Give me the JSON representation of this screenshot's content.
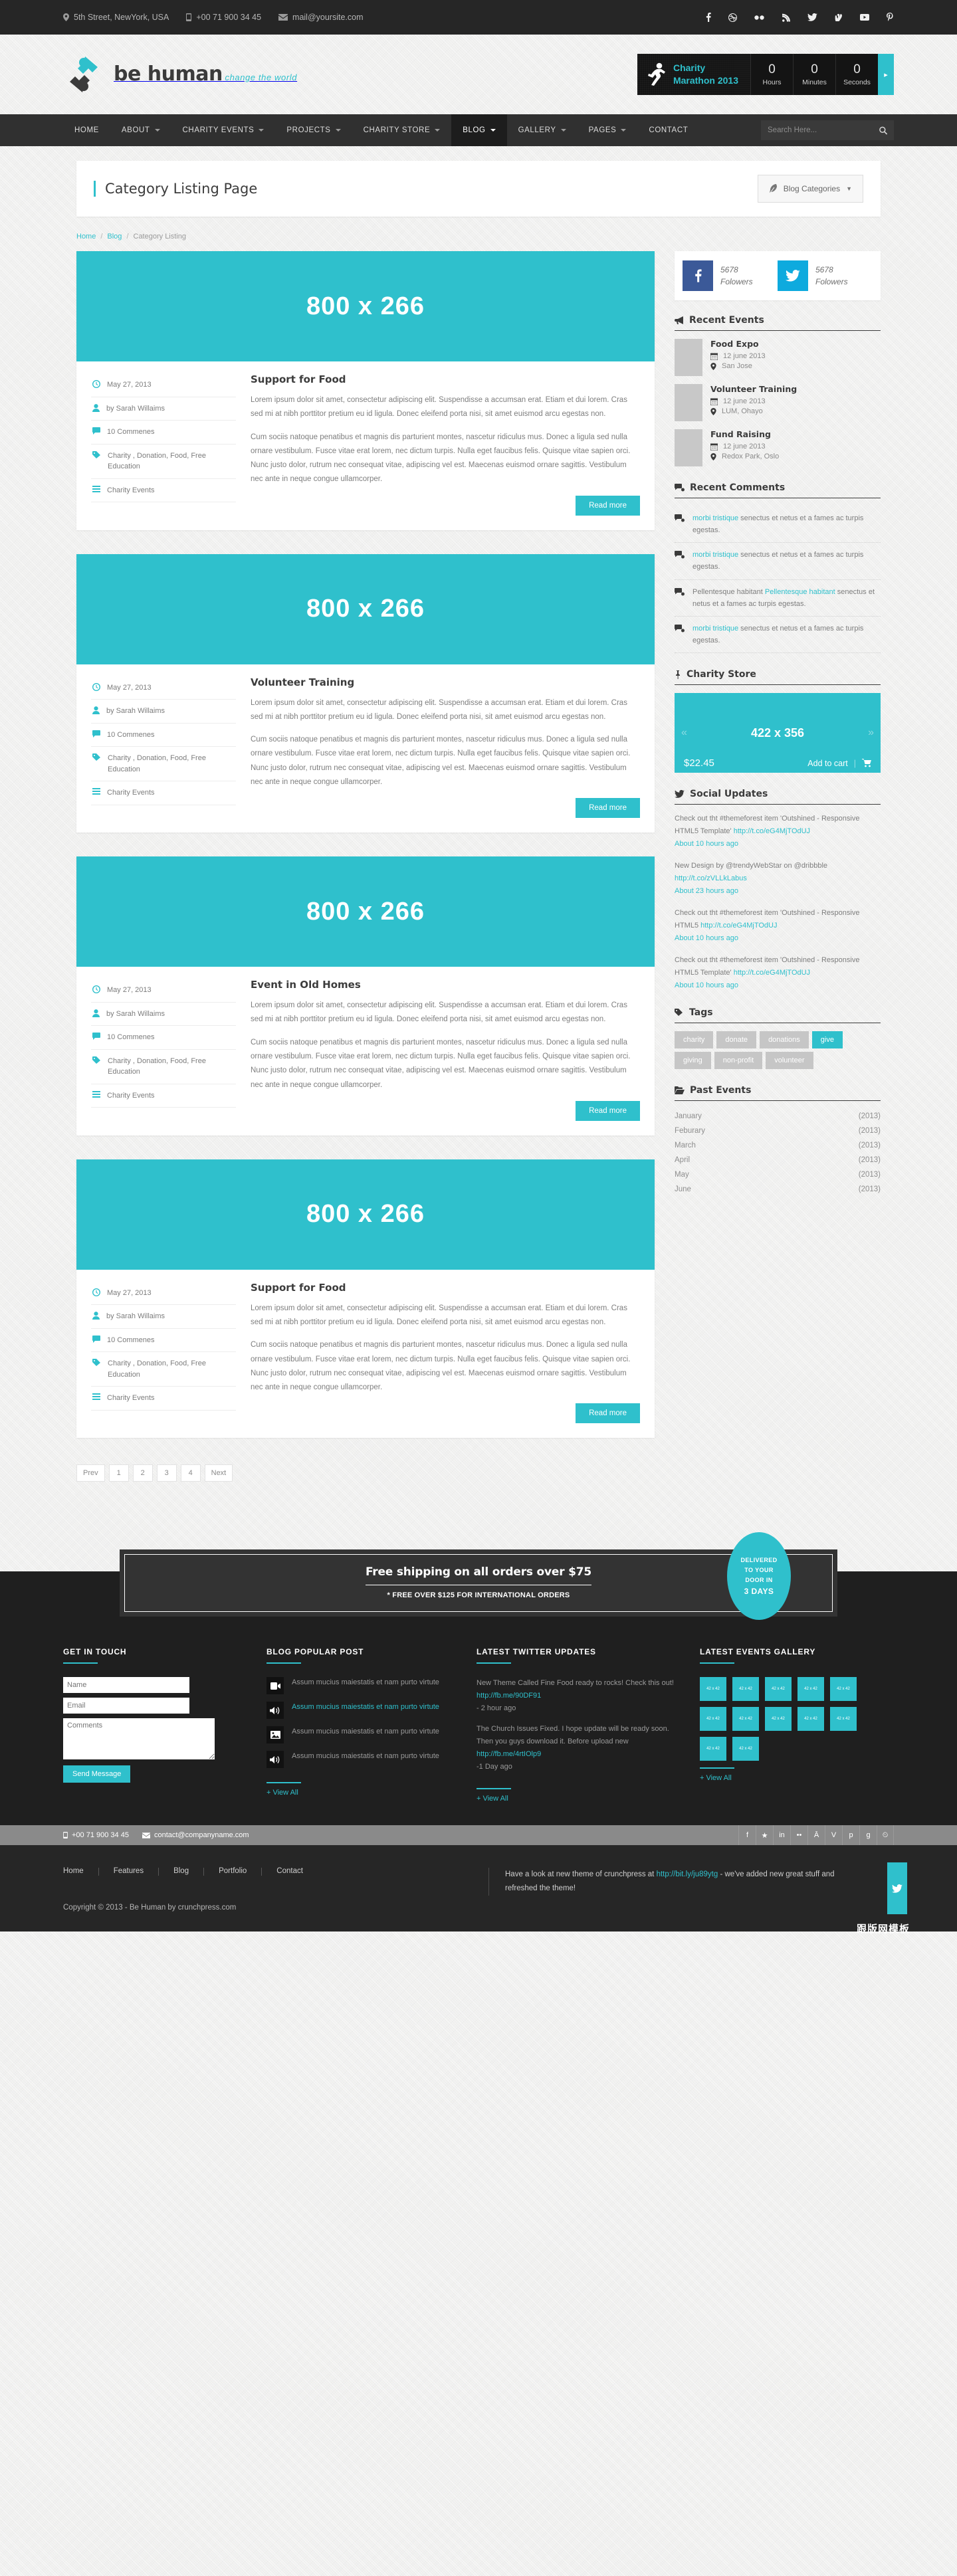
{
  "topbar": {
    "address": "5th Street, NewYork, USA",
    "phone": "+00 71 900 34 45",
    "email": "mail@yoursite.com",
    "social": [
      "facebook-icon",
      "dribbble-icon",
      "flickr-icon",
      "rss-icon",
      "twitter-icon",
      "vimeo-icon",
      "youtube-icon",
      "pinterest-icon"
    ]
  },
  "logo": {
    "name": "be human",
    "tagline": "change the world"
  },
  "countdown": {
    "title_line1": "Charity",
    "title_line2": "Marathon 2013",
    "units": [
      {
        "value": "0",
        "label": "Hours"
      },
      {
        "value": "0",
        "label": "Minutes"
      },
      {
        "value": "0",
        "label": "Seconds"
      }
    ]
  },
  "nav": {
    "items": [
      {
        "label": "HOME",
        "caret": false,
        "active": false
      },
      {
        "label": "ABOUT",
        "caret": true,
        "active": false
      },
      {
        "label": "CHARITY EVENTS",
        "caret": true,
        "active": false
      },
      {
        "label": "PROJECTS",
        "caret": true,
        "active": false
      },
      {
        "label": "CHARITY STORE",
        "caret": true,
        "active": false
      },
      {
        "label": "BLOG",
        "caret": true,
        "active": true
      },
      {
        "label": "GALLERY",
        "caret": true,
        "active": false
      },
      {
        "label": "PAGES",
        "caret": true,
        "active": false
      },
      {
        "label": "CONTACT",
        "caret": false,
        "active": false
      }
    ],
    "search_placeholder": "Search Here..."
  },
  "page": {
    "title": "Category Listing Page",
    "categories_button": "Blog Categories",
    "breadcrumb": [
      {
        "label": "Home",
        "link": true
      },
      {
        "label": "Blog",
        "link": true
      },
      {
        "label": "Category Listing",
        "link": false
      }
    ]
  },
  "posts": [
    {
      "image_label": "800 x 266",
      "title": "Support for Food",
      "date": "May 27, 2013",
      "author": "by Sarah Willaims",
      "comments": "10 Commenes",
      "tags": "Charity , Donation, Food, Free Education",
      "category": "Charity Events",
      "p1": "Lorem ipsum dolor sit amet, consectetur adipiscing elit. Suspendisse a accumsan erat. Etiam et dui lorem. Cras sed mi at nibh porttitor pretium eu id ligula. Donec eleifend porta nisi, sit amet euismod arcu egestas non.",
      "p2": "Cum sociis natoque penatibus et magnis dis parturient montes, nascetur ridiculus mus. Donec a ligula sed nulla ornare vestibulum. Fusce vitae erat lorem, nec dictum turpis. Nulla eget faucibus felis. Quisque vitae sapien orci. Nunc justo dolor, rutrum nec consequat vitae, adipiscing vel est. Maecenas euismod ornare sagittis. Vestibulum nec ante in neque congue ullamcorper.",
      "read_more": "Read more"
    },
    {
      "image_label": "800 x 266",
      "title": "Volunteer Training",
      "date": "May 27, 2013",
      "author": "by Sarah Willaims",
      "comments": "10 Commenes",
      "tags": "Charity , Donation, Food, Free Education",
      "category": "Charity Events",
      "p1": "Lorem ipsum dolor sit amet, consectetur adipiscing elit. Suspendisse a accumsan erat. Etiam et dui lorem. Cras sed mi at nibh porttitor pretium eu id ligula. Donec eleifend porta nisi, sit amet euismod arcu egestas non.",
      "p2": "Cum sociis natoque penatibus et magnis dis parturient montes, nascetur ridiculus mus. Donec a ligula sed nulla ornare vestibulum. Fusce vitae erat lorem, nec dictum turpis. Nulla eget faucibus felis. Quisque vitae sapien orci. Nunc justo dolor, rutrum nec consequat vitae, adipiscing vel est. Maecenas euismod ornare sagittis. Vestibulum nec ante in neque congue ullamcorper.",
      "read_more": "Read more"
    },
    {
      "image_label": "800 x 266",
      "title": "Event in Old Homes",
      "date": "May 27, 2013",
      "author": "by Sarah Willaims",
      "comments": "10 Commenes",
      "tags": "Charity , Donation, Food, Free Education",
      "category": "Charity Events",
      "p1": "Lorem ipsum dolor sit amet, consectetur adipiscing elit. Suspendisse a accumsan erat. Etiam et dui lorem. Cras sed mi at nibh porttitor pretium eu id ligula. Donec eleifend porta nisi, sit amet euismod arcu egestas non.",
      "p2": "Cum sociis natoque penatibus et magnis dis parturient montes, nascetur ridiculus mus. Donec a ligula sed nulla ornare vestibulum. Fusce vitae erat lorem, nec dictum turpis. Nulla eget faucibus felis. Quisque vitae sapien orci. Nunc justo dolor, rutrum nec consequat vitae, adipiscing vel est. Maecenas euismod ornare sagittis. Vestibulum nec ante in neque congue ullamcorper.",
      "read_more": "Read more"
    },
    {
      "image_label": "800 x 266",
      "title": "Support for Food",
      "date": "May 27, 2013",
      "author": "by Sarah Willaims",
      "comments": "10 Commenes",
      "tags": "Charity , Donation, Food, Free Education",
      "category": "Charity Events",
      "p1": "Lorem ipsum dolor sit amet, consectetur adipiscing elit. Suspendisse a accumsan erat. Etiam et dui lorem. Cras sed mi at nibh porttitor pretium eu id ligula. Donec eleifend porta nisi, sit amet euismod arcu egestas non.",
      "p2": "Cum sociis natoque penatibus et magnis dis parturient montes, nascetur ridiculus mus. Donec a ligula sed nulla ornare vestibulum. Fusce vitae erat lorem, nec dictum turpis. Nulla eget faucibus felis. Quisque vitae sapien orci. Nunc justo dolor, rutrum nec consequat vitae, adipiscing vel est. Maecenas euismod ornare sagittis. Vestibulum nec ante in neque congue ullamcorper.",
      "read_more": "Read more"
    }
  ],
  "pagination": [
    "Prev",
    "1",
    "2",
    "3",
    "4",
    "Next"
  ],
  "sidebar": {
    "followers": [
      {
        "network": "facebook",
        "count": "5678",
        "label": "Folowers"
      },
      {
        "network": "twitter",
        "count": "5678",
        "label": "Folowers"
      }
    ],
    "recent_events": {
      "heading": "Recent Events",
      "items": [
        {
          "title": "Food Expo",
          "date": "12 june 2013",
          "place": "San Jose"
        },
        {
          "title": "Volunteer Training",
          "date": "12 june 2013",
          "place": "LUM, Ohayo"
        },
        {
          "title": "Fund Raising",
          "date": "12 june 2013",
          "place": "Redox Park, Oslo"
        }
      ]
    },
    "recent_comments": {
      "heading": "Recent Comments",
      "items": [
        {
          "link": "morbi tristique",
          "rest": " senectus et netus et a fames ac turpis egestas.",
          "pre": ""
        },
        {
          "link": "morbi tristique",
          "rest": " senectus et netus et a fames ac turpis egestas.",
          "pre": ""
        },
        {
          "link": "Pellentesque habitant",
          "rest": " senectus et netus et a fames ac turpis egestas.",
          "pre": "Pellentesque habitant "
        },
        {
          "link": "morbi tristique",
          "rest": " senectus et netus et a fames ac turpis egestas.",
          "pre": ""
        }
      ]
    },
    "charity_store": {
      "heading": "Charity Store",
      "image_label": "422 x 356",
      "price": "$22.45",
      "add_to_cart": "Add to cart",
      "prev": "«",
      "next": "»"
    },
    "social_updates": {
      "heading": "Social Updates",
      "items": [
        {
          "text": "Check out tht #themeforest item 'Outshined - Responsive HTML5 Template'",
          "link": "http://t.co/eG4MjTOdUJ",
          "ago": "About 10 hours ago"
        },
        {
          "text": "New Design by @trendyWebStar on @dribbble ",
          "link": "http://t.co/zVLLkLabus",
          "ago": "About 23 hours ago"
        },
        {
          "text": "Check out tht #themeforest item 'Outshined - Responsive HTML5 ",
          "link": "http://t.co/eG4MjTOdUJ",
          "ago": "About 10 hours ago"
        },
        {
          "text": "Check out tht #themeforest item 'Outshined - Responsive HTML5 Template'",
          "link": "http://t.co/eG4MjTOdUJ",
          "ago": "About 10 hours ago"
        }
      ]
    },
    "tags": {
      "heading": "Tags",
      "items": [
        {
          "label": "charity",
          "active": false
        },
        {
          "label": "donate",
          "active": false
        },
        {
          "label": "donations",
          "active": false
        },
        {
          "label": "give",
          "active": true
        },
        {
          "label": "giving",
          "active": false
        },
        {
          "label": "non-profit",
          "active": false
        },
        {
          "label": "volunteer",
          "active": false
        }
      ]
    },
    "past_events": {
      "heading": "Past Events",
      "items": [
        {
          "month": "January",
          "year": "(2013)"
        },
        {
          "month": "Feburary",
          "year": "(2013)"
        },
        {
          "month": "March",
          "year": "(2013)"
        },
        {
          "month": "April",
          "year": "(2013)"
        },
        {
          "month": "May",
          "year": "(2013)"
        },
        {
          "month": "June",
          "year": "(2013)"
        }
      ]
    }
  },
  "shipping": {
    "line1": "Free shipping on all orders over $75",
    "line2": "* FREE OVER $125 FOR INTERNATIONAL ORDERS",
    "badge": [
      "DELIVERED",
      "TO YOUR",
      "DOOR IN",
      "3 DAYS"
    ]
  },
  "footer": {
    "contact": {
      "heading": "GET IN TOUCH",
      "name_placeholder": "Name",
      "email_placeholder": "Email",
      "comments_placeholder": "Comments",
      "send_label": "Send Message"
    },
    "popular": {
      "heading": "BLOG POPULAR POST",
      "items": [
        {
          "icon": "video-icon",
          "text": "Assum mucius maiestatis et nam purto virtute",
          "active": false
        },
        {
          "icon": "audio-icon",
          "text": "Assum mucius maiestatis et nam purto virtute",
          "active": true
        },
        {
          "icon": "image-icon",
          "text": "Assum mucius maiestatis et nam purto virtute",
          "active": false
        },
        {
          "icon": "audio-icon",
          "text": "Assum mucius maiestatis et nam purto virtute",
          "active": false
        }
      ],
      "view_all": "+ View All"
    },
    "twitter": {
      "heading": "LATEST TWITTER UPDATES",
      "items": [
        {
          "text": "New Theme Called Fine Food ready to rocks! Check this out!",
          "link": "http://fb.me/90DF91",
          "ago": "- 2 hour ago"
        },
        {
          "text": "The Church Issues Fixed. I hope update will be ready soon. Then you guys download it. Before upload new",
          "link": "http://fb.me/4rtIOlp9",
          "ago": "-1 Day ago"
        }
      ],
      "view_all": "+ View All"
    },
    "gallery": {
      "heading": "LATEST EVENTS GALLERY",
      "thumb_label": "42 x 42",
      "count": 12,
      "view_all": "+ View All"
    }
  },
  "footbar": {
    "phone": "+00 71 900 34 45",
    "email": "contact@companyname.com",
    "social": [
      "facebook-icon",
      "twitter-icon",
      "linkedin-icon",
      "flickr-icon",
      "behance-icon",
      "vimeo-icon",
      "pinterest-icon",
      "googleplus-icon",
      "rss-icon"
    ]
  },
  "footbottom": {
    "nav": [
      "Home",
      "Features",
      "Blog",
      "Portfolio",
      "Contact"
    ],
    "copyright": "Copyright © 2013 - Be Human by crunchpress.com",
    "tweet_pre": "Have a look at new theme of crunchpress at ",
    "tweet_link": "http://bit.ly/ju89ytg",
    "tweet_post": " - we've added new great stuff and refreshed the theme!",
    "watermark": "跟版网模板"
  }
}
